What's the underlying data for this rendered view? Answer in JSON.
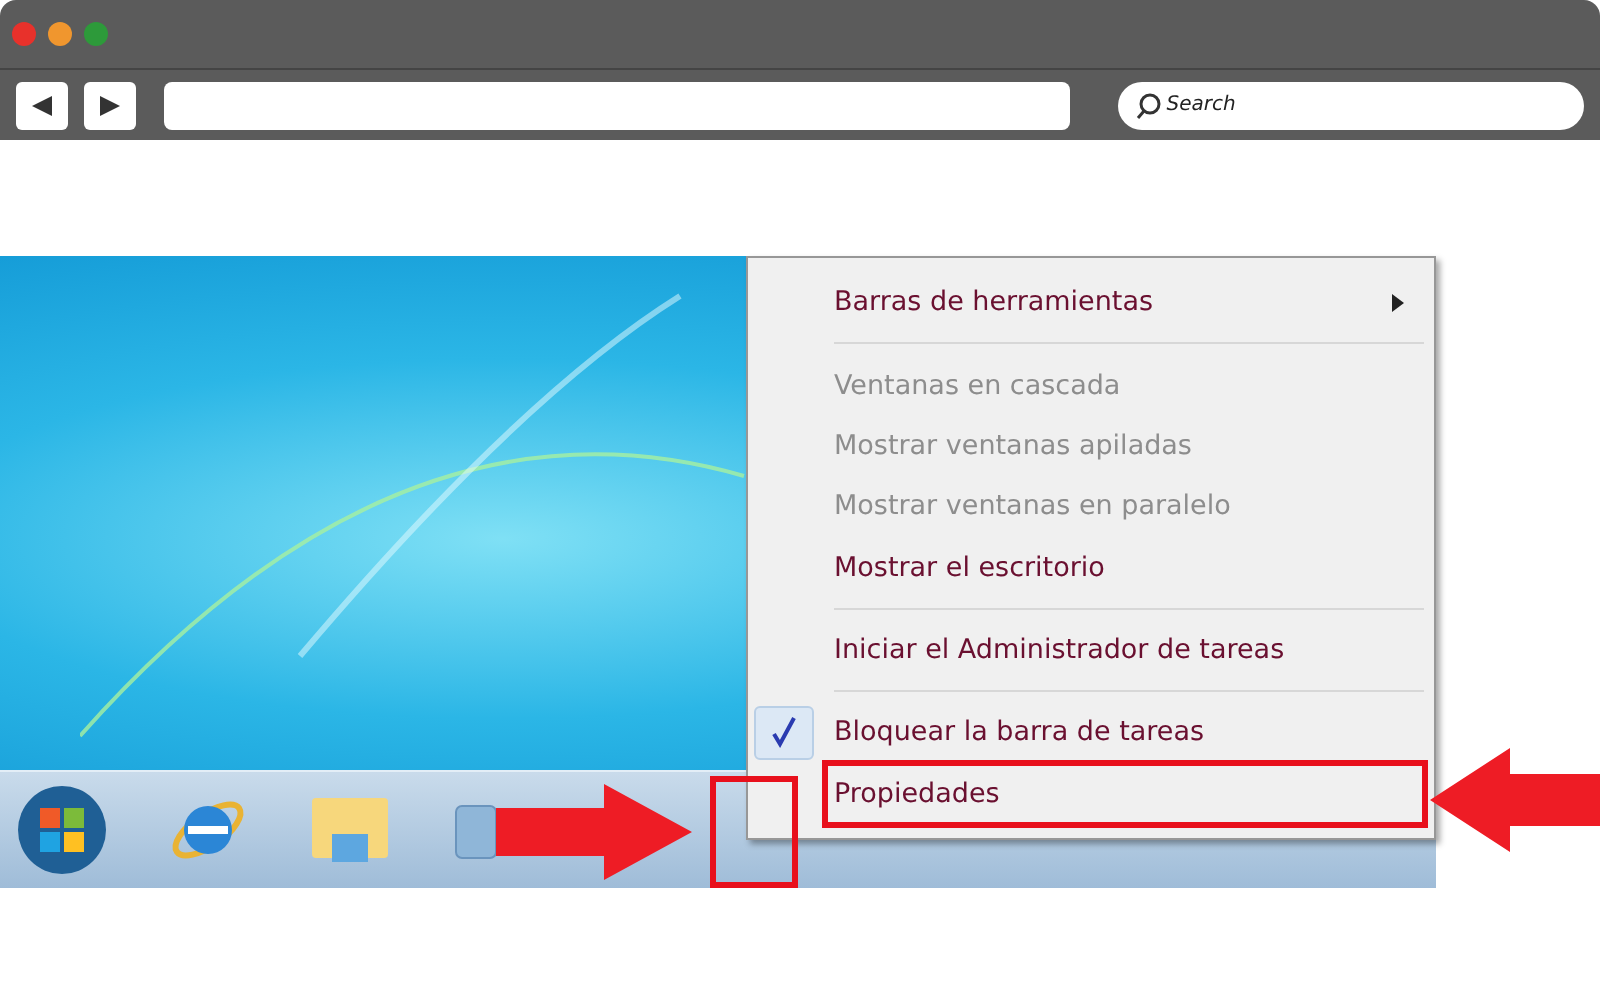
{
  "browser": {
    "search": {
      "placeholder": "Search"
    }
  },
  "context_menu": {
    "items": [
      {
        "kind": "item",
        "label": "Barras de herramientas",
        "disabled": false,
        "checked": false,
        "submenu": true,
        "highlighted": false
      },
      {
        "kind": "separator"
      },
      {
        "kind": "item",
        "label": "Ventanas en cascada",
        "disabled": true,
        "checked": false,
        "submenu": false,
        "highlighted": false
      },
      {
        "kind": "item",
        "label": "Mostrar ventanas apiladas",
        "disabled": true,
        "checked": false,
        "submenu": false,
        "highlighted": false
      },
      {
        "kind": "item",
        "label": "Mostrar ventanas en paralelo",
        "disabled": true,
        "checked": false,
        "submenu": false,
        "highlighted": false
      },
      {
        "kind": "item",
        "label": "Mostrar el escritorio",
        "disabled": false,
        "checked": false,
        "submenu": false,
        "highlighted": false
      },
      {
        "kind": "separator"
      },
      {
        "kind": "item",
        "label": "Iniciar el Administrador de tareas",
        "disabled": false,
        "checked": false,
        "submenu": false,
        "highlighted": false
      },
      {
        "kind": "separator"
      },
      {
        "kind": "item",
        "label": "Bloquear la barra de tareas",
        "disabled": false,
        "checked": true,
        "submenu": false,
        "highlighted": false
      },
      {
        "kind": "item",
        "label": "Propiedades",
        "disabled": false,
        "checked": false,
        "submenu": false,
        "highlighted": true
      }
    ]
  }
}
